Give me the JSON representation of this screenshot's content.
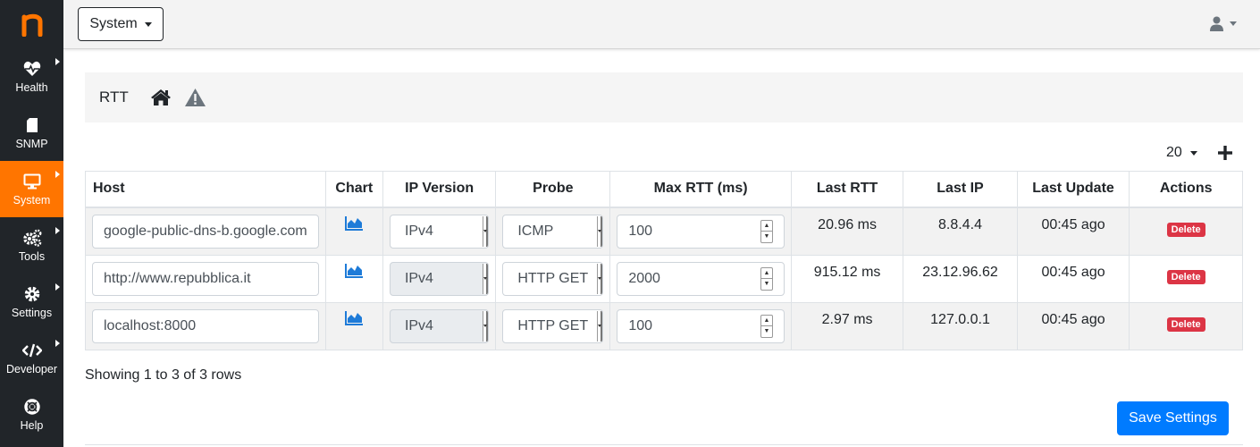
{
  "app": {
    "logo_letter": "n",
    "brand_color": "#ff7500"
  },
  "sidebar": {
    "items": [
      {
        "label": "Health",
        "icon": "heartbeat-icon",
        "active": false
      },
      {
        "label": "SNMP",
        "icon": "sd-card-icon",
        "active": false
      },
      {
        "label": "System",
        "icon": "desktop-icon",
        "active": true
      },
      {
        "label": "Tools",
        "icon": "cogs-icon",
        "active": false
      },
      {
        "label": "Settings",
        "icon": "gear-icon",
        "active": false
      },
      {
        "label": "Developer",
        "icon": "code-icon",
        "active": false
      },
      {
        "label": "Help",
        "icon": "life-ring-icon",
        "active": false
      }
    ]
  },
  "topbar": {
    "interface_selector": "System",
    "user_icon": "user-icon"
  },
  "breadcrumb": {
    "title": "RTT",
    "home_icon": "home-icon",
    "alert_icon": "warning-icon"
  },
  "toolbar": {
    "page_size": "20",
    "add_icon": "plus-icon"
  },
  "table": {
    "headers": [
      "Host",
      "Chart",
      "IP Version",
      "Probe",
      "Max RTT (ms)",
      "Last RTT",
      "Last IP",
      "Last Update",
      "Actions"
    ],
    "rows": [
      {
        "host": "google-public-dns-b.google.com",
        "ip_version": "IPv4",
        "probe": "ICMP",
        "max_rtt": "100",
        "last_rtt": "20.96 ms",
        "last_ip": "8.8.4.4",
        "last_update": "00:45 ago",
        "action": "Delete"
      },
      {
        "host": "http://www.repubblica.it",
        "ip_version": "IPv4",
        "probe": "HTTP GET",
        "max_rtt": "2000",
        "last_rtt": "915.12 ms",
        "last_ip": "23.12.96.62",
        "last_update": "00:45 ago",
        "action": "Delete"
      },
      {
        "host": "localhost:8000",
        "ip_version": "IPv4",
        "probe": "HTTP GET",
        "max_rtt": "100",
        "last_rtt": "2.97 ms",
        "last_ip": "127.0.0.1",
        "last_update": "00:45 ago",
        "action": "Delete"
      }
    ]
  },
  "footer": {
    "showing": "Showing 1 to 3 of 3 rows",
    "save_label": "Save Settings"
  }
}
